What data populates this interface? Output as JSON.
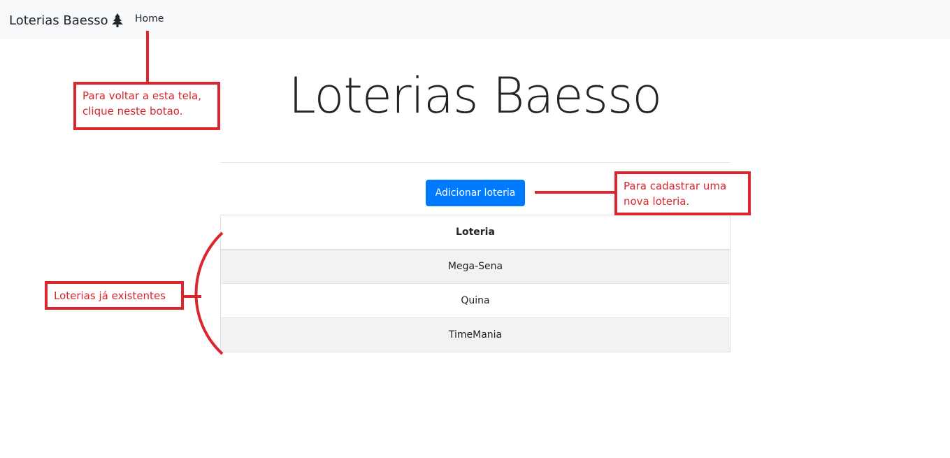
{
  "navbar": {
    "brand": "Loterias Baesso",
    "brand_icon": "tree-icon",
    "home_link": "Home"
  },
  "main": {
    "title": "Loterias Baesso",
    "add_button": "Adicionar loteria",
    "table": {
      "header": "Loteria",
      "rows": [
        "Mega-Sena",
        "Quina",
        "TimeMania"
      ]
    }
  },
  "annotations": {
    "home_note": "Para voltar a esta tela,\nclique neste botao.",
    "add_note": "Para cadastrar uma\nnova loteria.",
    "list_note": "Loterias já existentes",
    "color": "#d9262f"
  },
  "colors": {
    "primary": "#007bff",
    "navbar_bg": "#f8f9fa",
    "stripe": "#f2f2f2"
  }
}
